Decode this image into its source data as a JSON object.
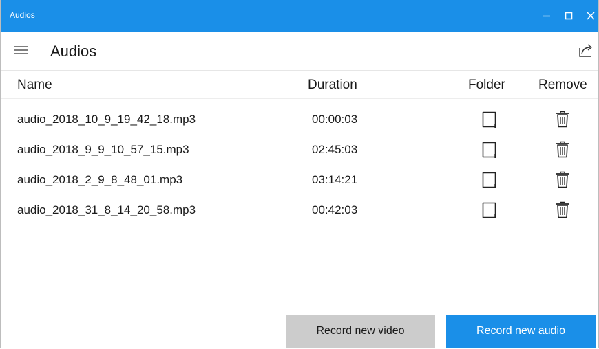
{
  "window": {
    "title": "Audios",
    "accent_color": "#1a8fe8"
  },
  "appbar": {
    "title": "Audios",
    "menu_icon": "hamburger-icon",
    "share_icon": "share-icon"
  },
  "table": {
    "columns": {
      "name": "Name",
      "duration": "Duration",
      "folder": "Folder",
      "remove": "Remove"
    },
    "rows": [
      {
        "name": "audio_2018_10_9_19_42_18.mp3",
        "duration": "00:00:03"
      },
      {
        "name": "audio_2018_9_9_10_57_15.mp3",
        "duration": "02:45:03"
      },
      {
        "name": "audio_2018_2_9_8_48_01.mp3",
        "duration": "03:14:21"
      },
      {
        "name": "audio_2018_31_8_14_20_58.mp3",
        "duration": "00:42:03"
      }
    ]
  },
  "actions": {
    "record_video": "Record new video",
    "record_audio": "Record new audio"
  }
}
